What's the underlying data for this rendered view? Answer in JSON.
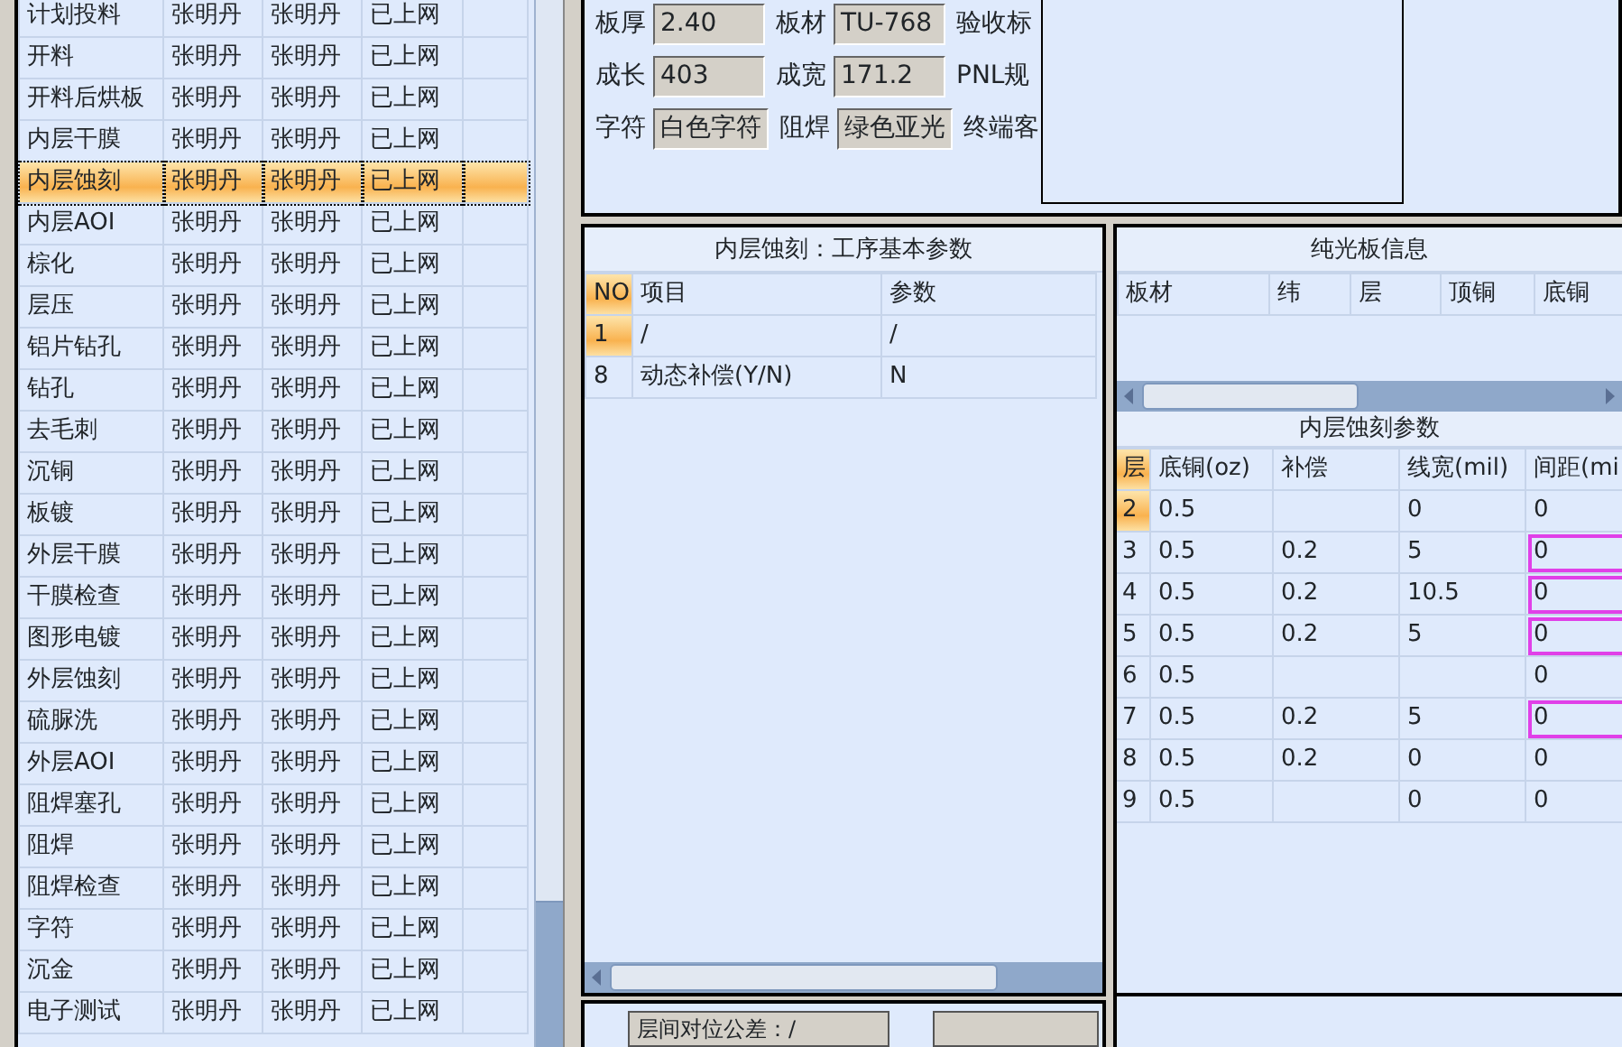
{
  "process_list": {
    "rows": [
      {
        "cells": [
          "计划投料",
          "张明丹",
          "张明丹",
          "已上网"
        ],
        "selected": false
      },
      {
        "cells": [
          "开料",
          "张明丹",
          "张明丹",
          "已上网"
        ],
        "selected": false
      },
      {
        "cells": [
          "开料后烘板",
          "张明丹",
          "张明丹",
          "已上网"
        ],
        "selected": false
      },
      {
        "cells": [
          "内层干膜",
          "张明丹",
          "张明丹",
          "已上网"
        ],
        "selected": false
      },
      {
        "cells": [
          "内层蚀刻",
          "张明丹",
          "张明丹",
          "已上网"
        ],
        "selected": true
      },
      {
        "cells": [
          "内层AOI",
          "张明丹",
          "张明丹",
          "已上网"
        ],
        "selected": false
      },
      {
        "cells": [
          "棕化",
          "张明丹",
          "张明丹",
          "已上网"
        ],
        "selected": false
      },
      {
        "cells": [
          "层压",
          "张明丹",
          "张明丹",
          "已上网"
        ],
        "selected": false
      },
      {
        "cells": [
          "铝片钻孔",
          "张明丹",
          "张明丹",
          "已上网"
        ],
        "selected": false
      },
      {
        "cells": [
          "钻孔",
          "张明丹",
          "张明丹",
          "已上网"
        ],
        "selected": false
      },
      {
        "cells": [
          "去毛刺",
          "张明丹",
          "张明丹",
          "已上网"
        ],
        "selected": false
      },
      {
        "cells": [
          "沉铜",
          "张明丹",
          "张明丹",
          "已上网"
        ],
        "selected": false
      },
      {
        "cells": [
          "板镀",
          "张明丹",
          "张明丹",
          "已上网"
        ],
        "selected": false
      },
      {
        "cells": [
          "外层干膜",
          "张明丹",
          "张明丹",
          "已上网"
        ],
        "selected": false
      },
      {
        "cells": [
          "干膜检查",
          "张明丹",
          "张明丹",
          "已上网"
        ],
        "selected": false
      },
      {
        "cells": [
          "图形电镀",
          "张明丹",
          "张明丹",
          "已上网"
        ],
        "selected": false
      },
      {
        "cells": [
          "外层蚀刻",
          "张明丹",
          "张明丹",
          "已上网"
        ],
        "selected": false
      },
      {
        "cells": [
          "硫脲洗",
          "张明丹",
          "张明丹",
          "已上网"
        ],
        "selected": false
      },
      {
        "cells": [
          "外层AOI",
          "张明丹",
          "张明丹",
          "已上网"
        ],
        "selected": false
      },
      {
        "cells": [
          "阻焊塞孔",
          "张明丹",
          "张明丹",
          "已上网"
        ],
        "selected": false
      },
      {
        "cells": [
          "阻焊",
          "张明丹",
          "张明丹",
          "已上网"
        ],
        "selected": false
      },
      {
        "cells": [
          "阻焊检查",
          "张明丹",
          "张明丹",
          "已上网"
        ],
        "selected": false
      },
      {
        "cells": [
          "字符",
          "张明丹",
          "张明丹",
          "已上网"
        ],
        "selected": false
      },
      {
        "cells": [
          "沉金",
          "张明丹",
          "张明丹",
          "已上网"
        ],
        "selected": false
      },
      {
        "cells": [
          "电子测试",
          "张明丹",
          "张明丹",
          "已上网"
        ],
        "selected": false
      }
    ]
  },
  "board_info": {
    "rows": [
      [
        {
          "label": "板厚",
          "value": "2.40"
        },
        {
          "label": "板材",
          "value": "TU-768"
        },
        {
          "label": "验收标"
        }
      ],
      [
        {
          "label": "成长",
          "value": "403"
        },
        {
          "label": "成宽",
          "value": "171.2"
        },
        {
          "label": "PNL规"
        }
      ],
      [
        {
          "label": "字符",
          "value": "白色字符"
        },
        {
          "label": "阻焊",
          "value": "绿色亚光"
        },
        {
          "label": "终端客"
        }
      ]
    ]
  },
  "basic_params": {
    "title": "内层蚀刻：工序基本参数",
    "columns": [
      "NO",
      "项目",
      "参数"
    ],
    "rows": [
      {
        "cells": [
          "1",
          "/",
          "/"
        ],
        "selected": true
      },
      {
        "cells": [
          "8",
          "动态补偿(Y/N)",
          "N"
        ],
        "selected": false
      }
    ]
  },
  "bare_board": {
    "title": "纯光板信息",
    "columns": [
      "板材",
      "纬",
      "层",
      "顶铜",
      "底铜"
    ]
  },
  "etch_params": {
    "title": "内层蚀刻参数",
    "columns": [
      "层",
      "底铜(oz)",
      "补偿",
      "线宽(mil)",
      "间距(mi"
    ],
    "rows": [
      {
        "cells": [
          "2",
          "0.5",
          null,
          "0",
          "0"
        ],
        "selected": true,
        "highlighted": false
      },
      {
        "cells": [
          "3",
          "0.5",
          "0.2",
          "5",
          "0"
        ],
        "selected": false,
        "highlighted": true
      },
      {
        "cells": [
          "4",
          "0.5",
          "0.2",
          "10.5",
          "0"
        ],
        "selected": false,
        "highlighted": true
      },
      {
        "cells": [
          "5",
          "0.5",
          "0.2",
          "5",
          "0"
        ],
        "selected": false,
        "highlighted": true
      },
      {
        "cells": [
          "6",
          "0.5",
          null,
          null,
          "0"
        ],
        "selected": false,
        "highlighted": false
      },
      {
        "cells": [
          "7",
          "0.5",
          "0.2",
          "5",
          "0"
        ],
        "selected": false,
        "highlighted": true
      },
      {
        "cells": [
          "8",
          "0.5",
          "0.2",
          "0",
          "0"
        ],
        "selected": false,
        "highlighted": false
      },
      {
        "cells": [
          "9",
          "0.5",
          null,
          "0",
          "0"
        ],
        "selected": false,
        "highlighted": false
      }
    ]
  },
  "tolerance_list": {
    "items": [
      "层间对位公差：/"
    ]
  }
}
